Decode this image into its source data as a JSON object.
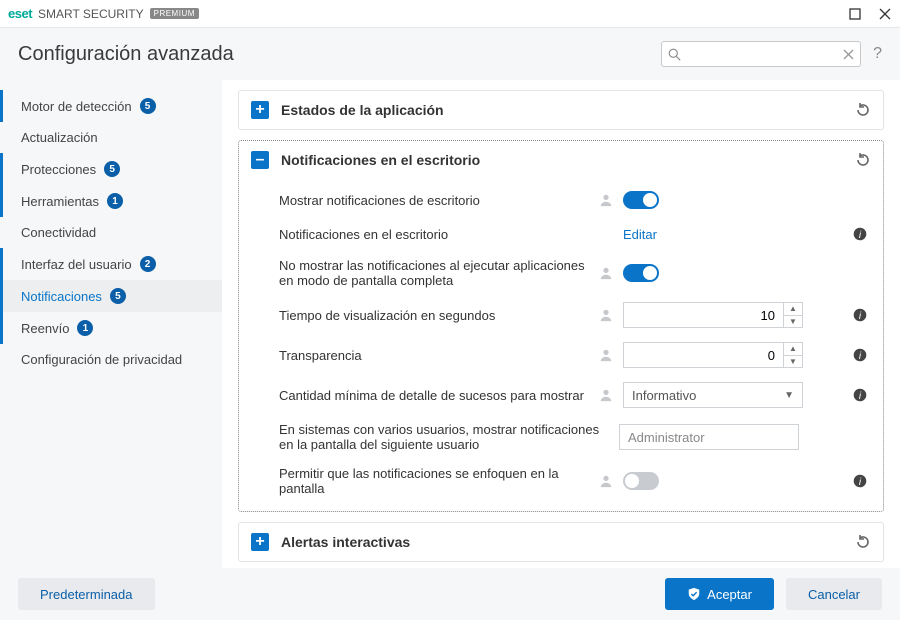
{
  "titlebar": {
    "brand_logo": "eset",
    "product": "SMART SECURITY",
    "edition": "PREMIUM"
  },
  "header": {
    "title": "Configuración avanzada",
    "search_placeholder": ""
  },
  "sidebar": {
    "items": [
      {
        "label": "Motor de detección",
        "badge": "5"
      },
      {
        "label": "Actualización",
        "badge": null
      },
      {
        "label": "Protecciones",
        "badge": "5"
      },
      {
        "label": "Herramientas",
        "badge": "1"
      },
      {
        "label": "Conectividad",
        "badge": null
      },
      {
        "label": "Interfaz del usuario",
        "badge": "2"
      },
      {
        "label": "Notificaciones",
        "badge": "5"
      },
      {
        "label": "Reenvío",
        "badge": "1"
      },
      {
        "label": "Configuración de privacidad",
        "badge": null
      }
    ]
  },
  "sections": {
    "app_states": {
      "title": "Estados de la aplicación"
    },
    "desktop_notifs": {
      "title": "Notificaciones en el escritorio",
      "rows": {
        "show": "Mostrar notificaciones de escritorio",
        "list": "Notificaciones en el escritorio",
        "edit": "Editar",
        "fullscreen": "No mostrar las notificaciones al ejecutar aplicaciones en modo de pantalla completa",
        "time": "Tiempo de visualización en segundos",
        "time_val": "10",
        "transparency": "Transparencia",
        "transparency_val": "0",
        "verbosity": "Cantidad mínima de detalle de sucesos para mostrar",
        "verbosity_val": "Informativo",
        "multiuser": "En sistemas con varios usuarios, mostrar notificaciones en la pantalla del siguiente usuario",
        "multiuser_val": "Administrator",
        "focus": "Permitir que las notificaciones se enfoquen en la pantalla"
      }
    },
    "interactive_alerts": {
      "title": "Alertas interactivas"
    }
  },
  "footer": {
    "default": "Predeterminada",
    "accept": "Aceptar",
    "cancel": "Cancelar"
  }
}
